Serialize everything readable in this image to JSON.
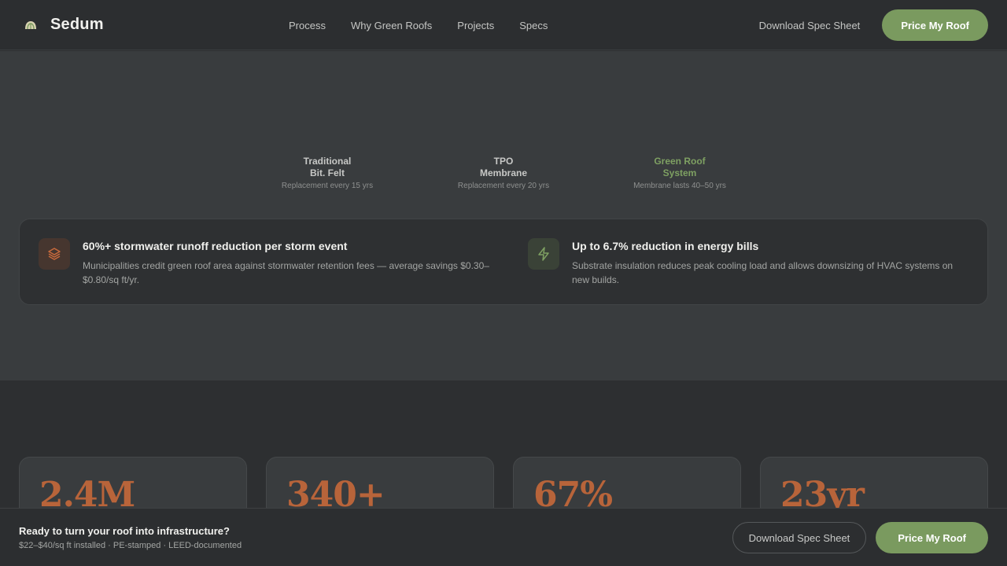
{
  "header": {
    "brand": "Sedum",
    "nav": [
      "Process",
      "Why Green Roofs",
      "Projects",
      "Specs"
    ],
    "download_label": "Download Spec Sheet",
    "cta_label": "Price My Roof"
  },
  "comparison": [
    {
      "title_line1": "Traditional",
      "title_line2": "Bit. Felt",
      "sub": "Replacement every 15 yrs"
    },
    {
      "title_line1": "TPO",
      "title_line2": "Membrane",
      "sub": "Replacement every 20 yrs"
    },
    {
      "title_line1": "Green Roof",
      "title_line2": "System",
      "sub": "Membrane lasts 40–50 yrs"
    }
  ],
  "benefits": [
    {
      "icon": "layers-icon",
      "title": "60%+ stormwater runoff reduction per storm event",
      "desc": "Municipalities credit green roof area against stormwater retention fees — average savings $0.30–$0.80/sq ft/yr."
    },
    {
      "icon": "lightning-icon",
      "title": "Up to 6.7% reduction in energy bills",
      "desc": "Substrate insulation reduces peak cooling load and allows downsizing of HVAC systems on new builds."
    }
  ],
  "stats": [
    "2.4M",
    "340+",
    "67%",
    "23yr"
  ],
  "cta_bar": {
    "title": "Ready to turn your roof into infrastructure?",
    "sub": "$22–$40/sq ft installed · PE-stamped · LEED-documented",
    "download_label": "Download Spec Sheet",
    "cta_label": "Price My Roof"
  },
  "colors": {
    "accent_green": "#7a9a5f",
    "accent_orange": "#b8643a",
    "background": "#2d2f31"
  }
}
